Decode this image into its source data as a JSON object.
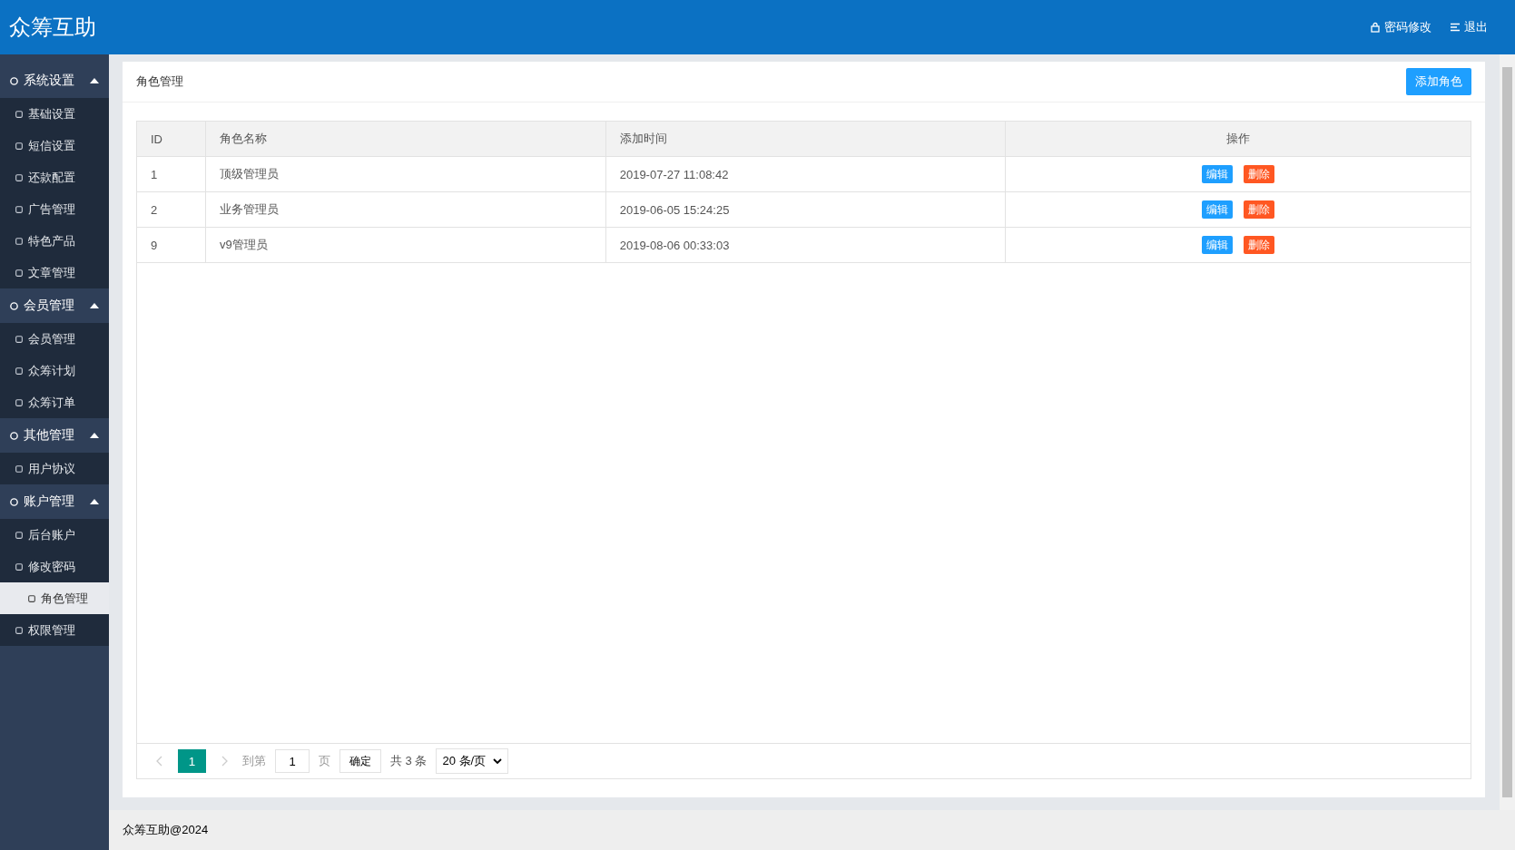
{
  "header": {
    "logo": "众筹互助",
    "links": [
      {
        "label": "密码修改"
      },
      {
        "label": "退出"
      }
    ]
  },
  "sidebar": {
    "groups": [
      {
        "label": "系统设置",
        "expanded": true,
        "items": [
          {
            "label": "基础设置",
            "selected": false
          },
          {
            "label": "短信设置",
            "selected": false
          },
          {
            "label": "还款配置",
            "selected": false
          },
          {
            "label": "广告管理",
            "selected": false
          },
          {
            "label": "特色产品",
            "selected": false
          },
          {
            "label": "文章管理",
            "selected": false
          }
        ]
      },
      {
        "label": "会员管理",
        "expanded": true,
        "items": [
          {
            "label": "会员管理",
            "selected": false
          },
          {
            "label": "众筹计划",
            "selected": false
          },
          {
            "label": "众筹订单",
            "selected": false
          }
        ]
      },
      {
        "label": "其他管理",
        "expanded": true,
        "items": [
          {
            "label": "用户协议",
            "selected": false
          }
        ]
      },
      {
        "label": "账户管理",
        "expanded": true,
        "items": [
          {
            "label": "后台账户",
            "selected": false
          },
          {
            "label": "修改密码",
            "selected": false
          },
          {
            "label": "角色管理",
            "selected": true
          },
          {
            "label": "权限管理",
            "selected": false
          }
        ]
      }
    ]
  },
  "panel": {
    "title": "角色管理",
    "add_button": "添加角色"
  },
  "table": {
    "columns": [
      "ID",
      "角色名称",
      "添加时间",
      "操作"
    ],
    "rows": [
      {
        "id": "1",
        "name": "顶级管理员",
        "time": "2019-07-27 11:08:42",
        "actions": [
          "编辑",
          "删除"
        ]
      },
      {
        "id": "2",
        "name": "业务管理员",
        "time": "2019-06-05 15:24:25",
        "actions": [
          "编辑",
          "删除"
        ]
      },
      {
        "id": "9",
        "name": "v9管理员",
        "time": "2019-08-06 00:33:03",
        "actions": [
          "编辑",
          "删除"
        ]
      }
    ]
  },
  "pagination": {
    "pages": [
      {
        "label": "1",
        "selected": true
      }
    ],
    "goto_label": "到第",
    "page_input": "1",
    "page_unit": "页",
    "confirm": "确定",
    "total": "共 3 条",
    "page_size": "20 条/页"
  },
  "footer": "众筹互助@2024"
}
